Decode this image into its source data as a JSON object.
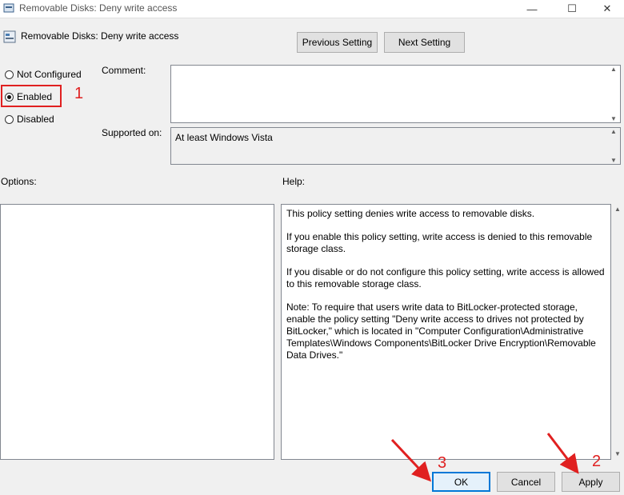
{
  "window": {
    "title": "Removable Disks: Deny write access",
    "minimize_glyph": "—",
    "maximize_glyph": "☐",
    "close_glyph": "✕"
  },
  "header": {
    "title": "Removable Disks: Deny write access",
    "prev_label": "Previous Setting",
    "next_label": "Next Setting"
  },
  "state": {
    "options": [
      {
        "label": "Not Configured",
        "checked": false
      },
      {
        "label": "Enabled",
        "checked": true
      },
      {
        "label": "Disabled",
        "checked": false
      }
    ]
  },
  "comment": {
    "label": "Comment:",
    "value": ""
  },
  "supported": {
    "label": "Supported on:",
    "value": "At least Windows Vista"
  },
  "options_label": "Options:",
  "help": {
    "label": "Help:",
    "paragraphs": [
      "This policy setting denies write access to removable disks.",
      "If you enable this policy setting, write access is denied to this removable storage class.",
      "If you disable or do not configure this policy setting, write access is allowed to this removable storage class.",
      "Note: To require that users write data to BitLocker-protected storage, enable the policy setting \"Deny write access to drives not protected by BitLocker,\" which is located in \"Computer Configuration\\Administrative Templates\\Windows Components\\BitLocker Drive Encryption\\Removable Data Drives.\""
    ]
  },
  "buttons": {
    "ok": "OK",
    "cancel": "Cancel",
    "apply": "Apply"
  },
  "annotations": {
    "n1": "1",
    "n2": "2",
    "n3": "3",
    "color": "#e02020"
  }
}
